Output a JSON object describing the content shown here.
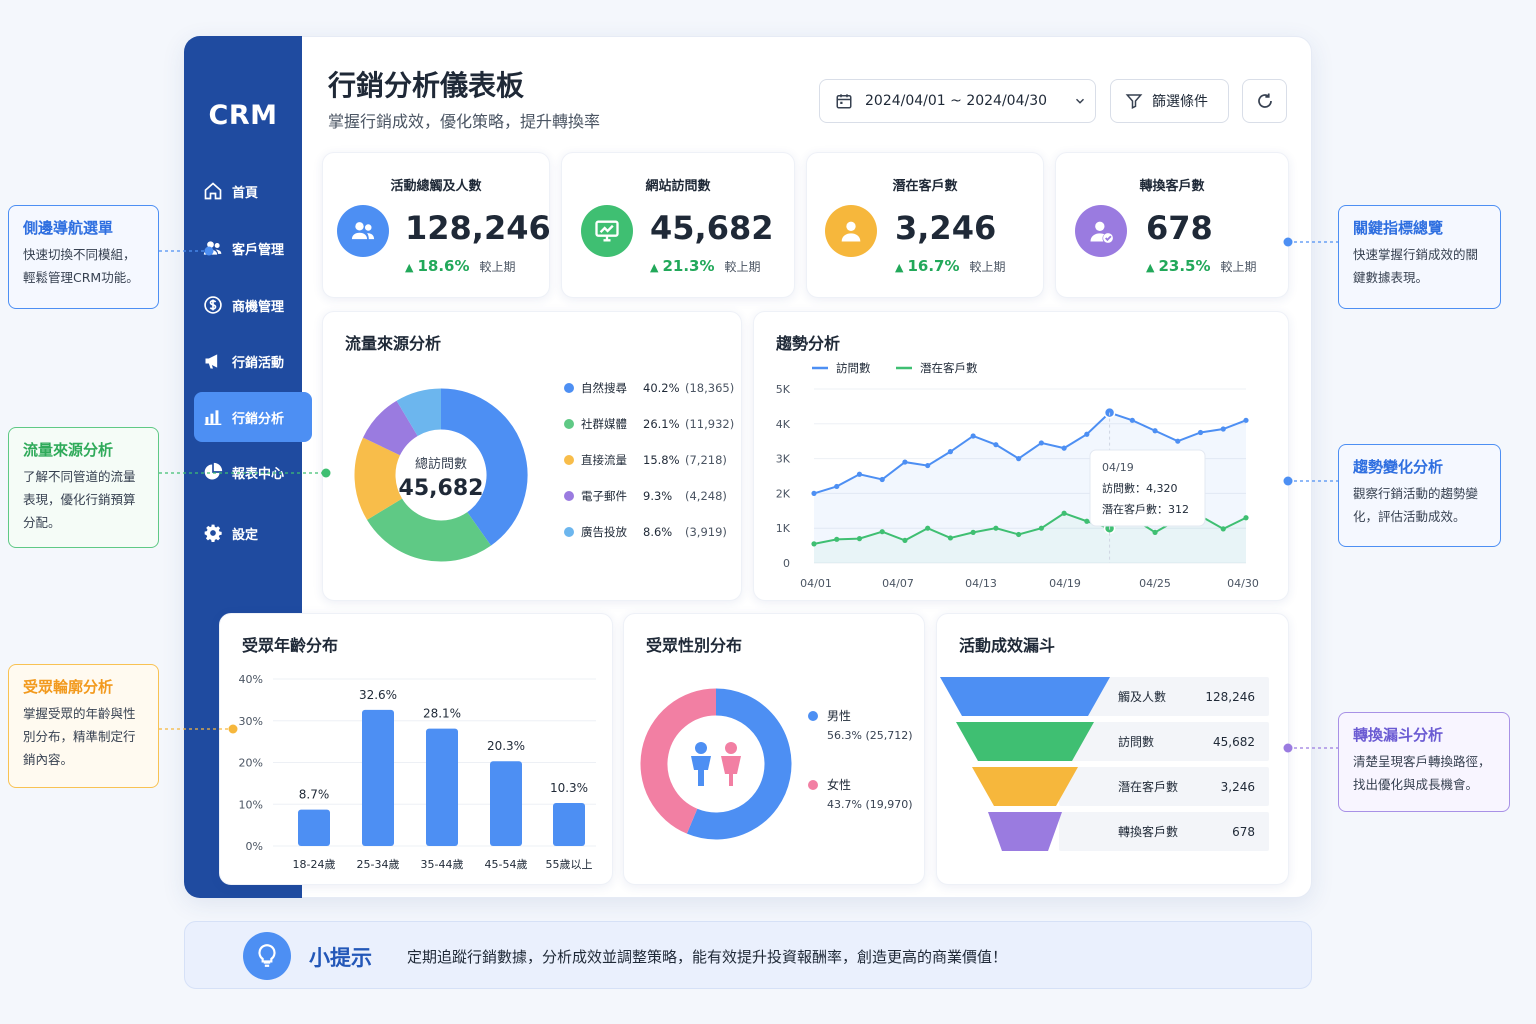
{
  "app": {
    "logo": "CRM"
  },
  "sidebar": {
    "items": [
      {
        "label": "首頁",
        "icon": "home-icon"
      },
      {
        "label": "客戶管理",
        "icon": "users-icon"
      },
      {
        "label": "商機管理",
        "icon": "dollar-icon"
      },
      {
        "label": "行銷活動",
        "icon": "megaphone-icon"
      },
      {
        "label": "行銷分析",
        "icon": "bar-chart-icon",
        "active": true
      },
      {
        "label": "報表中心",
        "icon": "pie-chart-icon"
      },
      {
        "label": "設定",
        "icon": "gear-icon"
      }
    ]
  },
  "header": {
    "title": "行銷分析儀表板",
    "subtitle": "掌握行銷成效，優化策略，提升轉換率",
    "date_range": "2024/04/01 ~ 2024/04/30",
    "filter_label": "篩選條件"
  },
  "kpis": [
    {
      "title": "活動總觸及人數",
      "value": "128,246",
      "delta": "18.6%",
      "delta_label": "較上期",
      "color": "#4d8ff3",
      "icon": "users-icon"
    },
    {
      "title": "網站訪問數",
      "value": "45,682",
      "delta": "21.3%",
      "delta_label": "較上期",
      "color": "#3fbf72",
      "icon": "monitor-chart-icon"
    },
    {
      "title": "潛在客戶數",
      "value": "3,246",
      "delta": "16.7%",
      "delta_label": "較上期",
      "color": "#f6b73c",
      "icon": "user-icon"
    },
    {
      "title": "轉換客戶數",
      "value": "678",
      "delta": "23.5%",
      "delta_label": "較上期",
      "color": "#9a7be0",
      "icon": "user-check-icon"
    }
  ],
  "traffic": {
    "title": "流量來源分析",
    "center_label": "總訪問數",
    "center_value": "45,682"
  },
  "trend": {
    "title": "趨勢分析"
  },
  "age": {
    "title": "受眾年齡分布"
  },
  "gender": {
    "title": "受眾性別分布"
  },
  "funnel": {
    "title": "活動成效漏斗"
  },
  "chart_data": [
    {
      "type": "pie",
      "title": "流量來源分析",
      "categories": [
        "自然搜尋",
        "社群媒體",
        "直接流量",
        "電子郵件",
        "廣告投放"
      ],
      "percents": [
        "40.2%",
        "26.1%",
        "15.8%",
        "9.3%",
        "8.6%"
      ],
      "values": [
        18365,
        11932,
        7218,
        4248,
        3919
      ],
      "value_labels": [
        "(18,365)",
        "(11,932)",
        "(7,218)",
        "(4,248)",
        "(3,919)"
      ],
      "colors": [
        "#4d8ff3",
        "#5fc985",
        "#f8bd4a",
        "#9a7be0",
        "#6cb6ee"
      ]
    },
    {
      "type": "line",
      "title": "趨勢分析",
      "x_ticks": [
        "04/01",
        "04/07",
        "04/13",
        "04/19",
        "04/25",
        "04/30"
      ],
      "y_ticks": [
        "0",
        "1K",
        "2K",
        "3K",
        "4K",
        "5K"
      ],
      "ylim": [
        0,
        5000
      ],
      "legend": "top-left",
      "series": [
        {
          "name": "訪問數",
          "color": "#4d8ff3",
          "values": [
            2000,
            2200,
            2550,
            2400,
            2900,
            2800,
            3200,
            3650,
            3400,
            3000,
            3450,
            3300,
            3700,
            4320,
            4100,
            3800,
            3500,
            3750,
            3850,
            4100
          ]
        },
        {
          "name": "潛在客戶數",
          "color": "#3fbf72",
          "values": [
            550,
            680,
            700,
            900,
            650,
            1000,
            720,
            880,
            1000,
            820,
            1000,
            1430,
            1200,
            1000,
            1300,
            880,
            1250,
            1350,
            980,
            1300
          ]
        }
      ],
      "tooltip": {
        "date": "04/19",
        "lines": [
          "訪問數：4,320",
          "潛在客戶數：312"
        ]
      }
    },
    {
      "type": "bar",
      "title": "受眾年齡分布",
      "categories": [
        "18-24歲",
        "25-34歲",
        "35-44歲",
        "45-54歲",
        "55歲以上"
      ],
      "values": [
        8.7,
        32.6,
        28.1,
        20.3,
        10.3
      ],
      "value_labels": [
        "8.7%",
        "32.6%",
        "28.1%",
        "20.3%",
        "10.3%"
      ],
      "y_ticks": [
        "0%",
        "10%",
        "20%",
        "30%",
        "40%"
      ],
      "ylim": [
        0,
        40
      ]
    },
    {
      "type": "pie",
      "title": "受眾性別分布",
      "categories": [
        "男性",
        "女性"
      ],
      "values": [
        56.3,
        43.7
      ],
      "details": [
        "56.3% (25,712)",
        "43.7% (19,970)"
      ],
      "colors": [
        "#4d8ff3",
        "#f27fa3"
      ]
    },
    {
      "type": "bar",
      "title": "活動成效漏斗",
      "categories": [
        "觸及人數",
        "訪問數",
        "潛在客戶數",
        "轉換客戶數"
      ],
      "values": [
        128246,
        45682,
        3246,
        678
      ],
      "value_labels": [
        "128,246",
        "45,682",
        "3,246",
        "678"
      ],
      "colors": [
        "#4d8ff3",
        "#3fbf72",
        "#f6b73c",
        "#9a7be0"
      ]
    }
  ],
  "callouts": [
    {
      "title": "側邊導航選單",
      "body": "快速切換不同模組，輕鬆管理CRM功能。",
      "color": "#2f6fe0"
    },
    {
      "title": "流量來源分析",
      "body": "了解不同管道的流量表現，優化行銷預算分配。",
      "color": "#2faa5a"
    },
    {
      "title": "受眾輪廓分析",
      "body": "掌握受眾的年齡與性別分布，精準制定行銷內容。",
      "color": "#f29a1e"
    },
    {
      "title": "關鍵指標總覽",
      "body": "快速掌握行銷成效的關鍵數據表現。",
      "color": "#2f6fe0"
    },
    {
      "title": "趨勢變化分析",
      "body": "觀察行銷活動的趨勢變化，評估活動成效。",
      "color": "#2f6fe0"
    },
    {
      "title": "轉換漏斗分析",
      "body": "清楚呈現客戶轉換路徑，找出優化與成長機會。",
      "color": "#6b5bd3"
    }
  ],
  "tips": {
    "title": "小提示",
    "text": "定期追蹤行銷數據，分析成效並調整策略，能有效提升投資報酬率，創造更高的商業價值！"
  }
}
